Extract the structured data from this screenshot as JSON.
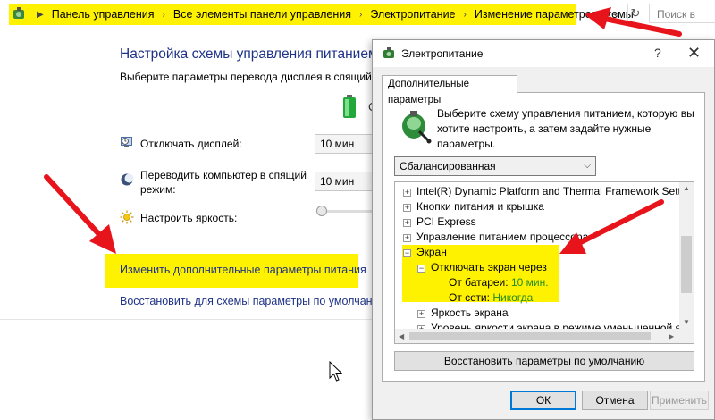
{
  "address_bar": {
    "breadcrumbs": [
      "Панель управления",
      "Все элементы панели управления",
      "Электропитание",
      "Изменение параметров схемы"
    ],
    "search_placeholder": "Поиск в"
  },
  "background": {
    "title": "Настройка схемы управления питанием \"",
    "subtitle": "Выберите параметры перевода дисплея в спящий реж",
    "plan_col_label": "С",
    "rows": [
      {
        "label": "Отключать дисплей:",
        "value": "10 мин"
      },
      {
        "label": "Переводить компьютер в спящий режим:",
        "value": "10 мин"
      },
      {
        "label": "Настроить яркость:"
      }
    ],
    "advanced_link": "Изменить дополнительные параметры питания",
    "restore_link": "Восстановить для схемы параметры по умолчанию"
  },
  "dialog": {
    "title": "Электропитание",
    "help": "?",
    "close": "✕",
    "tab": "Дополнительные параметры",
    "description": "Выберите схему управления питанием, которую вы хотите настроить, а затем задайте нужные параметры.",
    "plan": "Сбалансированная",
    "tree": {
      "items": [
        {
          "label": "Intel(R) Dynamic Platform and Thermal Framework Setting",
          "sign": "+"
        },
        {
          "label": "Кнопки питания и крышка",
          "sign": "+"
        },
        {
          "label": "PCI Express",
          "sign": "+"
        },
        {
          "label": "Управление питанием процессора",
          "sign": "+"
        },
        {
          "label": "Экран",
          "sign": "−"
        },
        {
          "label": "Отключать экран через",
          "sign": "−"
        }
      ],
      "battery_label": "От батареи:",
      "battery_value": "10 мин.",
      "ac_label": "От сети:",
      "ac_value": "Никогда",
      "brightness": "Яркость экрана",
      "dim_brightness": "Уровень яркости экрана в режиме уменьшенной я"
    },
    "restore_defaults": "Восстановить параметры по умолчанию",
    "ok": "ОК",
    "cancel": "Отмена",
    "apply": "Применить"
  },
  "colors": {
    "highlight": "#fff200",
    "arrow": "#e8141b",
    "link": "#1e3287",
    "tree_value": "#228b22"
  }
}
